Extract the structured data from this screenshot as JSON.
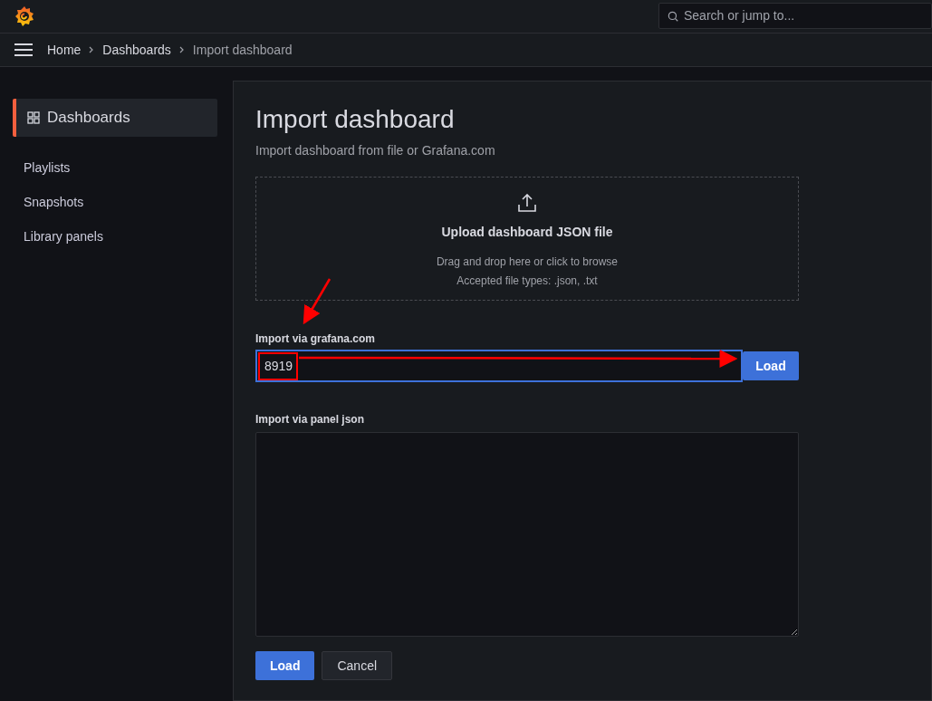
{
  "top_bar": {
    "search": {
      "placeholder": "Search or jump to..."
    }
  },
  "breadcrumbs": [
    {
      "label": "Home",
      "current": false
    },
    {
      "label": "Dashboards",
      "current": false
    },
    {
      "label": "Import dashboard",
      "current": true
    }
  ],
  "sidebar": {
    "items": [
      {
        "label": "Dashboards",
        "kind": "section",
        "selected": true
      },
      {
        "label": "Playlists",
        "kind": "link",
        "selected": false
      },
      {
        "label": "Snapshots",
        "kind": "link",
        "selected": false
      },
      {
        "label": "Library panels",
        "kind": "link",
        "selected": false
      }
    ]
  },
  "page": {
    "title": "Import dashboard",
    "subtitle": "Import dashboard from file or Grafana.com",
    "upload": {
      "title": "Upload dashboard JSON file",
      "hint": "Drag and drop here or click to browse",
      "accepted": "Accepted file types: .json, .txt"
    },
    "grafana_import": {
      "label": "Import via grafana.com",
      "value": "8919",
      "focused": true,
      "button": "Load"
    },
    "panel_json": {
      "label": "Import via panel json"
    },
    "buttons": [
      {
        "label": "Load",
        "kind": "primary"
      },
      {
        "label": "Cancel",
        "kind": "secondary"
      }
    ]
  }
}
